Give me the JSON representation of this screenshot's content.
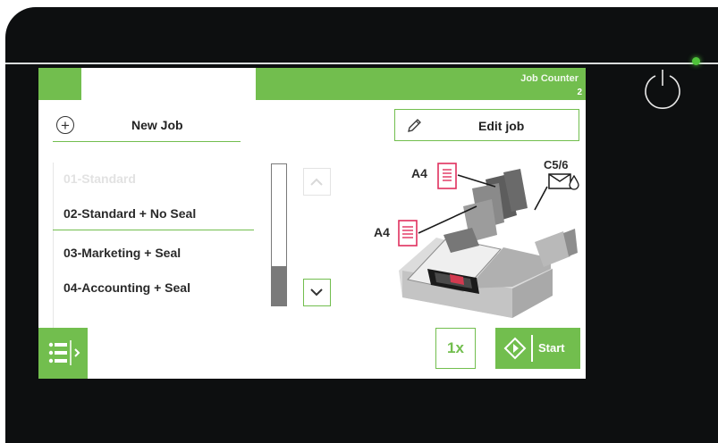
{
  "header": {
    "job_counter_label": "Job Counter",
    "job_counter_value": "2"
  },
  "actions": {
    "new_job_label": "New Job",
    "edit_job_label": "Edit job"
  },
  "job_list": {
    "items": [
      {
        "label": "01-Standard",
        "state": "disabled"
      },
      {
        "label": "02-Standard + No Seal",
        "state": "selected"
      },
      {
        "label": "03-Marketing + Seal",
        "state": "normal"
      },
      {
        "label": "04-Accounting + Seal",
        "state": "normal"
      }
    ],
    "scroll_position": 0.72
  },
  "machine": {
    "upper_feeder_label": "A4",
    "lower_feeder_label": "A4",
    "envelope_label": "C5/6"
  },
  "footer": {
    "quantity_label": "1x",
    "start_label": "Start"
  },
  "colors": {
    "accent": "#72be4e",
    "document_icon": "#e0305e",
    "bezel": "#0d0f10",
    "status_led": "#4fc43a"
  }
}
